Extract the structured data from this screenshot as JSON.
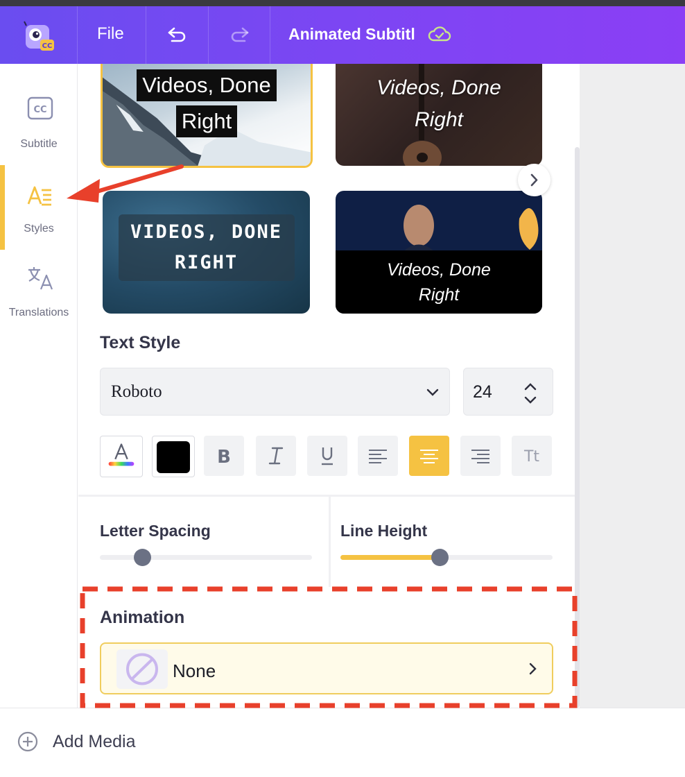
{
  "header": {
    "file_label": "File",
    "project_title": "Animated Subtitle"
  },
  "sidebar": {
    "items": [
      {
        "label": "Subtitle",
        "icon": "cc-icon",
        "active": false
      },
      {
        "label": "Styles",
        "icon": "text-style-icon",
        "active": true
      },
      {
        "label": "Translations",
        "icon": "translate-icon",
        "active": false
      }
    ]
  },
  "style_presets": [
    {
      "line1": "Videos, Done",
      "line2": "Right",
      "selected": true
    },
    {
      "line1": "Videos, Done",
      "line2": "Right",
      "selected": false
    },
    {
      "line1": "VIDEOS, DONE",
      "line2": "RIGHT",
      "selected": false
    },
    {
      "line1": "Videos, Done",
      "line2": "Right",
      "selected": false
    }
  ],
  "text_style": {
    "heading": "Text Style",
    "font": "Roboto",
    "size": "24",
    "text_color": "#000000",
    "accent": "#f5c242",
    "alignment": "center"
  },
  "letter_spacing": {
    "label": "Letter Spacing",
    "value": 0.2
  },
  "line_height": {
    "label": "Line Height",
    "value": 0.47
  },
  "animation": {
    "heading": "Animation",
    "value": "None"
  },
  "bottom": {
    "add_media_label": "Add Media"
  },
  "annotation_color": "#e8402b"
}
